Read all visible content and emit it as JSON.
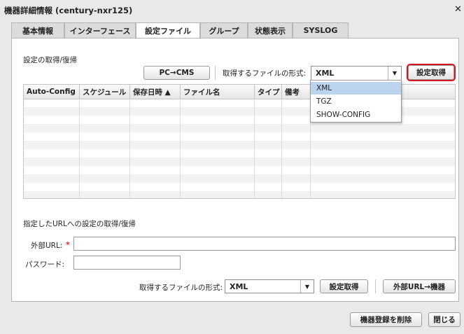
{
  "window": {
    "title": "機器詳細情報 (century-nxr125)"
  },
  "tabs": [
    {
      "label": "基本情報"
    },
    {
      "label": "インターフェース"
    },
    {
      "label": "設定ファイル"
    },
    {
      "label": "グループ"
    },
    {
      "label": "状態表示"
    },
    {
      "label": "SYSLOG"
    }
  ],
  "active_tab": "設定ファイル",
  "section1": {
    "title": "設定の取得/復帰",
    "pc_cms_button": "PC→CMS",
    "format_label": "取得するファイルの形式:",
    "format_value": "XML",
    "get_button": "設定取得"
  },
  "table": {
    "columns": [
      "Auto-Config",
      "スケジュール",
      "保存日時 ▲",
      "ファイル名",
      "タイプ",
      "備考"
    ]
  },
  "dropdown": {
    "options": [
      "XML",
      "TGZ",
      "SHOW-CONFIG"
    ],
    "selected": "XML"
  },
  "section2": {
    "title": "指定したURLへの設定の取得/復帰",
    "url_label": "外部URL:",
    "required_mark": "*",
    "password_label": "パスワード:",
    "format_label": "取得するファイルの形式:",
    "format_value": "XML",
    "get_button": "設定取得",
    "url_to_device_button": "外部URL→機器"
  },
  "footer": {
    "delete_button": "機器登録を削除",
    "close_button": "閉じる"
  },
  "icons": {
    "close": "close-icon",
    "dropdown": "chevron-down-icon"
  },
  "colors": {
    "highlight": "#d4161e",
    "selected_option": "#bcd3ee",
    "required": "#e0242f"
  }
}
